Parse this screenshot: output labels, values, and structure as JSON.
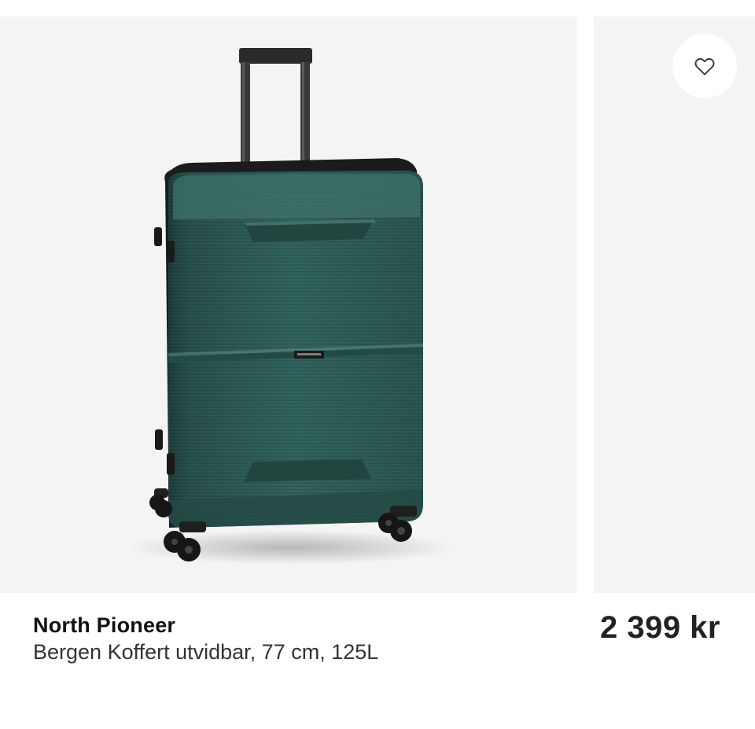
{
  "product": {
    "brand": "North Pioneer",
    "name": "Bergen Koffert utvidbar, 77 cm, 125L",
    "price": "2 399 kr",
    "image_subject": "suitcase-image",
    "colors": {
      "suitcase": "#2e5a55",
      "background": "#f4f4f4"
    }
  },
  "next_card": {
    "favorite_icon": "heart-icon"
  }
}
